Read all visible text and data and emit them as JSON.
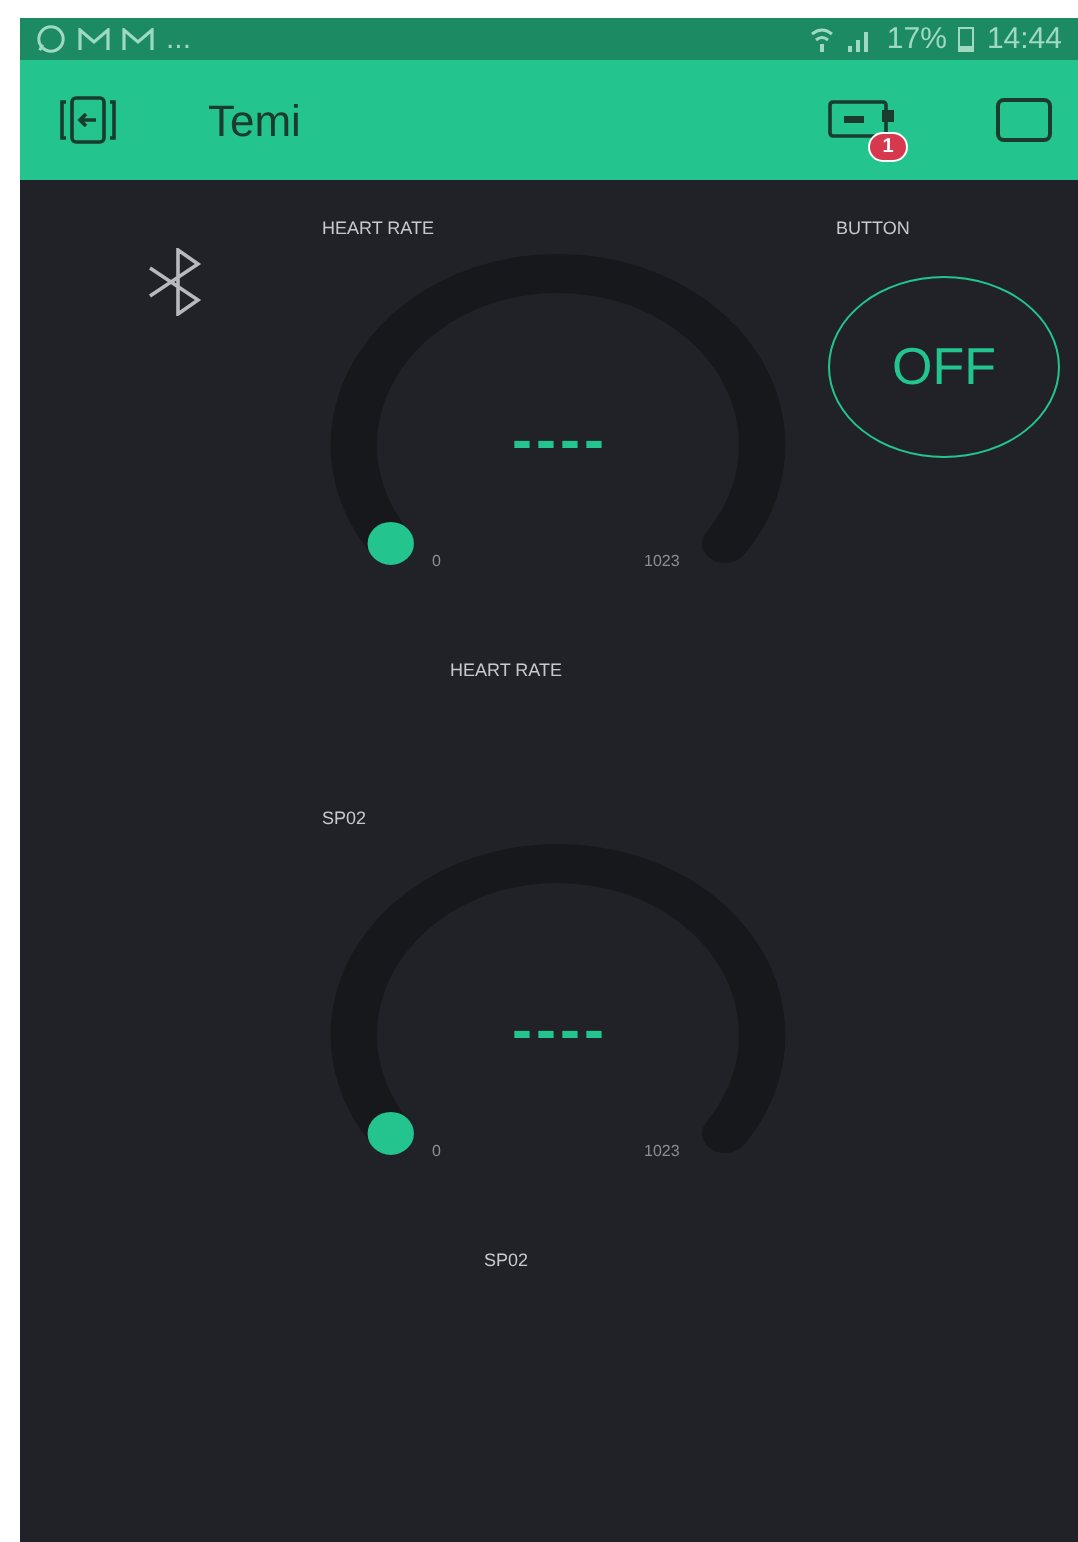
{
  "status_bar": {
    "overflow": "...",
    "battery": "17%",
    "time": "14:44"
  },
  "app_bar": {
    "title": "Temi",
    "device_badge": "1"
  },
  "widgets": [
    {
      "kind": "bluetooth"
    },
    {
      "kind": "gauge",
      "label": "HEART RATE",
      "value": "----",
      "min": "0",
      "max": "1023",
      "level": 0,
      "caption": "HEART RATE"
    },
    {
      "kind": "button",
      "label": "BUTTON",
      "text": "OFF",
      "on": false
    },
    {
      "kind": "gauge",
      "label": "SP02",
      "value": "----",
      "min": "0",
      "max": "1023",
      "level": 0,
      "caption": "SP02"
    }
  ]
}
